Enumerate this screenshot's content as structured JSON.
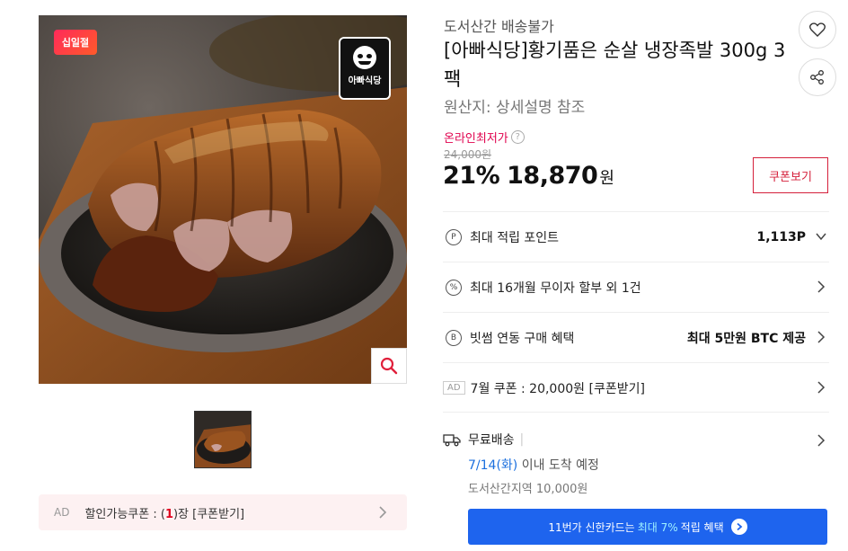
{
  "product": {
    "badge": "십일절",
    "brand_logo_text": "아빠식당",
    "seller_note": "도서산간 배송불가",
    "title": "[아빠식당]황기품은 순살 냉장족발 300g 3팩",
    "origin": "원산지:  상세설명 참조",
    "lowest_label": "온라인최저가",
    "original_price": "24,000원",
    "discount": "21%",
    "price": "18,870",
    "currency": "원",
    "coupon_button": "쿠폰보기"
  },
  "ad_bar": {
    "tag": "AD",
    "label_prefix": "할인가능쿠폰 : (",
    "count": "1",
    "label_suffix": ")장 [쿠폰받기]"
  },
  "benefits": [
    {
      "icon": "P",
      "label": "최대 적립 포인트",
      "right": "1,113P",
      "chevron": "down"
    },
    {
      "icon": "%",
      "label": "최대 16개월 무이자 할부 외 1건",
      "right": "",
      "chevron": "right"
    },
    {
      "icon": "B",
      "label": "빗썸 연동 구매 혜택",
      "right": "최대 5만원 BTC 제공",
      "chevron": "right"
    },
    {
      "icon": "AD",
      "label": "7월 쿠폰 : 20,000원 [쿠폰받기]",
      "right": "",
      "chevron": "right"
    }
  ],
  "delivery": {
    "label": "무료배송",
    "separator": "|",
    "date": "7/14(화)",
    "date_suffix": " 이내 도착 예정",
    "area_fee": "도서산간지역 10,000원"
  },
  "card_promo": {
    "prefix": "11번가 신한카드는",
    "highlight": "최대 7%",
    "suffix": "적립 혜택"
  },
  "colors": {
    "accent_red": "#d5203b",
    "promo_blue": "#1e64ee",
    "date_blue": "#1b6fde"
  }
}
